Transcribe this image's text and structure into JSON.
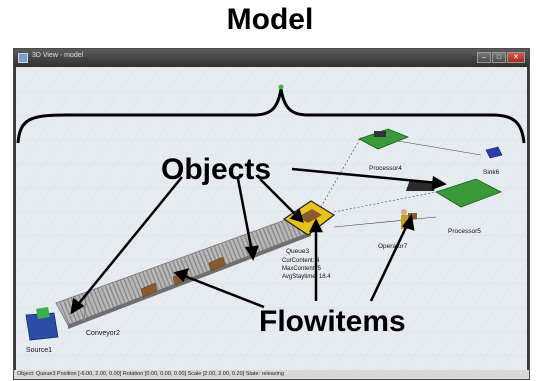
{
  "header": {
    "title": "Model"
  },
  "window": {
    "title": "3D View - model",
    "buttons": {
      "minimize": "–",
      "maximize": "□",
      "close": "✕"
    }
  },
  "scene": {
    "labels": {
      "source": "Source1",
      "conveyor": "Conveyor2",
      "queue": "Queue3",
      "operator": "Operator7",
      "processor4": "Processor4",
      "processor5": "Processor5",
      "sink": "Sink6"
    },
    "queue_stats": {
      "cur_content": "CurContent:  4",
      "max_content": "MaxContent:  5",
      "avg_staytime": "AvgStaytime: 18.4"
    }
  },
  "annotations": {
    "objects": "Objects",
    "flowitems": "Flowitems"
  },
  "status_bar": {
    "text": "Object: Queue3 Position [-6.00, 2.00, 0.00]  Rotation [0.00, 0.00, 0.00]  Scale [2.00, 2.00, 0.20]  State: releasing"
  },
  "colors": {
    "window_frame": "#3a3a3a",
    "viewport_bg": "#e6ebf0",
    "source_blue": "#2b4ea8",
    "queue_yellow": "#e8c21a",
    "processor_green": "#3a9a3a",
    "sink_blue": "#2a3aa8",
    "flowitem_brown": "#8a5a2a"
  }
}
